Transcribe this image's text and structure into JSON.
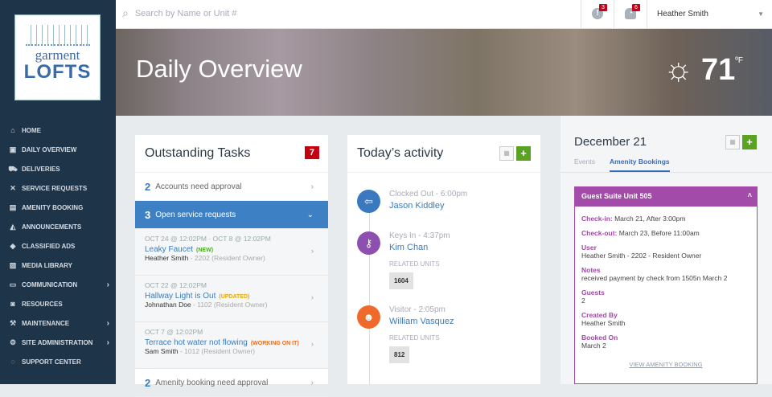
{
  "brand": {
    "line1": "garment",
    "line2": "LOFTS"
  },
  "sidebar": {
    "items": [
      {
        "label": "HOME",
        "icon": "⌂",
        "sub": false
      },
      {
        "label": "DAILY OVERVIEW",
        "icon": "▣",
        "sub": false
      },
      {
        "label": "DELIVERIES",
        "icon": "⛟",
        "sub": false
      },
      {
        "label": "SERVICE REQUESTS",
        "icon": "✕",
        "sub": false
      },
      {
        "label": "AMENITY BOOKING",
        "icon": "▤",
        "sub": false
      },
      {
        "label": "ANNOUNCEMENTS",
        "icon": "◭",
        "sub": false
      },
      {
        "label": "CLASSIFIED ADS",
        "icon": "◆",
        "sub": false
      },
      {
        "label": "MEDIA LIBRARY",
        "icon": "▨",
        "sub": false
      },
      {
        "label": "COMMUNICATION",
        "icon": "▭",
        "sub": true
      },
      {
        "label": "RESOURCES",
        "icon": "◙",
        "sub": false
      },
      {
        "label": "MAINTENANCE",
        "icon": "⚒",
        "sub": true
      },
      {
        "label": "SITE ADMINISTRATION",
        "icon": "⚙",
        "sub": true
      },
      {
        "label": "SUPPORT CENTER",
        "icon": "◌",
        "sub": false
      }
    ]
  },
  "topbar": {
    "search_placeholder": "Search by Name or Unit #",
    "alerts_count": "3",
    "notifications_count": "6",
    "user": "Heather Smith"
  },
  "banner": {
    "title": "Daily Overview",
    "temp": "71",
    "unit": "ºF"
  },
  "tasks": {
    "title": "Outstanding Tasks",
    "count": "7",
    "groups": [
      {
        "n": "2",
        "label": "Accounts need approval"
      },
      {
        "n": "3",
        "label": "Open service requests"
      },
      {
        "n": "2",
        "label": "Amenity booking need approval"
      }
    ],
    "requests": [
      {
        "date": "OCT 24 @ 12:02PM ·    OCT 8 @ 12:02PM",
        "title": "Leaky Faucet",
        "status": "(NEW)",
        "color": "#4caf24",
        "person": "Heather Smith",
        "unit": " - 2202 (Resident Owner)"
      },
      {
        "date": "OCT 22 @ 12:02PM",
        "title": "Hallway Light is Out",
        "status": "(UPDATED)",
        "color": "#e6a800",
        "person": "Johnathan Doe",
        "unit": " - 1102 (Resident Owner)"
      },
      {
        "date": "OCT 7 @ 12:02PM",
        "title": "Terrace hot water not flowing",
        "status": "(WORKING ON IT)",
        "color": "#ef6c1a",
        "person": "Sam Smith",
        "unit": " - 1012 (Resident Owner)"
      }
    ]
  },
  "activity": {
    "title": "Today’s activity",
    "related_label": "RELATED UNITS",
    "events": [
      {
        "kind": "Clocked Out - 6:00pm",
        "name": "Jason Kiddley",
        "color": "#3a78c0",
        "icon": "⇦"
      },
      {
        "kind": "Keys In - 4:37pm",
        "name": "Kim Chan",
        "unit": "1604",
        "color": "#8d50ae",
        "icon": "⚷"
      },
      {
        "kind": "Visitor - 2:05pm",
        "name": "William Vasquez",
        "unit": "812",
        "color": "#ef6a2a",
        "icon": "☻"
      }
    ]
  },
  "calendar": {
    "date": "December 21",
    "tabs": [
      "Events",
      "Amenity Bookings"
    ],
    "booking": {
      "title": "Guest Suite Unit 505",
      "checkin_label": "Check-in:",
      "checkin": " March 21, After 3:00pm",
      "checkout_label": "Check-out:",
      "checkout": " March 23, Before 11:00am",
      "fields": [
        {
          "label": "User",
          "value": "Heather Smith - 2202 - Resident Owner"
        },
        {
          "label": "Notes",
          "value": "received payment by check from 1505n March 2"
        },
        {
          "label": "Guests",
          "value": "2"
        },
        {
          "label": "Created By",
          "value": "Heather Smith"
        },
        {
          "label": "Booked On",
          "value": "March 2"
        }
      ],
      "link": "VIEW AMENITY BOOKING"
    }
  }
}
